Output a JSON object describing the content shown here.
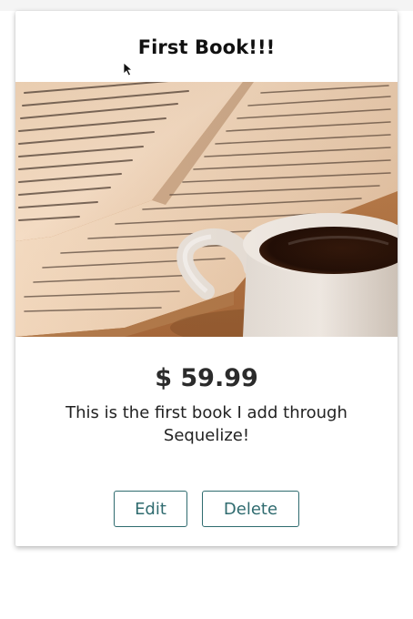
{
  "card": {
    "title": "First Book!!!",
    "price": "$ 59.99",
    "description": "This is the first book I add through Sequelize!",
    "image_alt": "Open book with a cup of coffee",
    "actions": {
      "edit_label": "Edit",
      "delete_label": "Delete"
    }
  },
  "colors": {
    "button_border": "#2f6b6f",
    "button_text": "#2f6b6f",
    "title_text": "#111111",
    "price_text": "#2b2b2b"
  },
  "icons": {
    "cursor": "mouse-pointer-icon"
  }
}
